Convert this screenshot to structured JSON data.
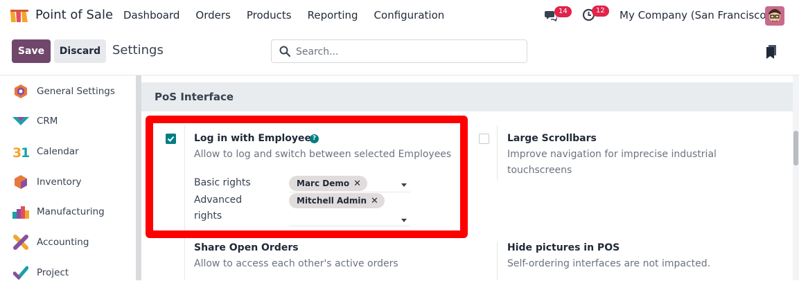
{
  "navbar": {
    "app_name": "Point of Sale",
    "menu": [
      "Dashboard",
      "Orders",
      "Products",
      "Reporting",
      "Configuration"
    ],
    "chat_badge": "14",
    "activity_badge": "12",
    "company": "My Company (San Francisco)"
  },
  "control_panel": {
    "save_label": "Save",
    "discard_label": "Discard",
    "breadcrumb": "Settings",
    "search_placeholder": "Search..."
  },
  "sidebar": {
    "items": [
      {
        "label": "General Settings",
        "icon": "general-settings-icon"
      },
      {
        "label": "CRM",
        "icon": "crm-icon"
      },
      {
        "label": "Calendar",
        "icon": "calendar-icon"
      },
      {
        "label": "Inventory",
        "icon": "inventory-icon"
      },
      {
        "label": "Manufacturing",
        "icon": "manufacturing-icon"
      },
      {
        "label": "Accounting",
        "icon": "accounting-icon"
      },
      {
        "label": "Project",
        "icon": "project-icon"
      }
    ]
  },
  "section": {
    "title": "PoS Interface",
    "settings": {
      "login_employees": {
        "title": "Log in with Employees",
        "desc": "Allow to log and switch between selected Employees",
        "checked": true,
        "basic_rights_label": "Basic rights",
        "advanced_rights_label_1": "Advanced",
        "advanced_rights_label_2": "rights",
        "basic_tag": "Marc Demo",
        "advanced_tag": "Mitchell Admin"
      },
      "large_scrollbars": {
        "title": "Large Scrollbars",
        "desc_1": "Improve navigation for imprecise industrial",
        "desc_2": "touchscreens",
        "checked": false
      },
      "share_orders": {
        "title": "Share Open Orders",
        "desc": "Allow to access each other's active orders"
      },
      "hide_pictures": {
        "title": "Hide pictures in POS",
        "desc": "Self-ordering interfaces are not impacted."
      }
    }
  },
  "colors": {
    "brand": "#71466b",
    "accent": "#017e84",
    "badge": "#e0244a",
    "highlight": "#ff0000"
  }
}
